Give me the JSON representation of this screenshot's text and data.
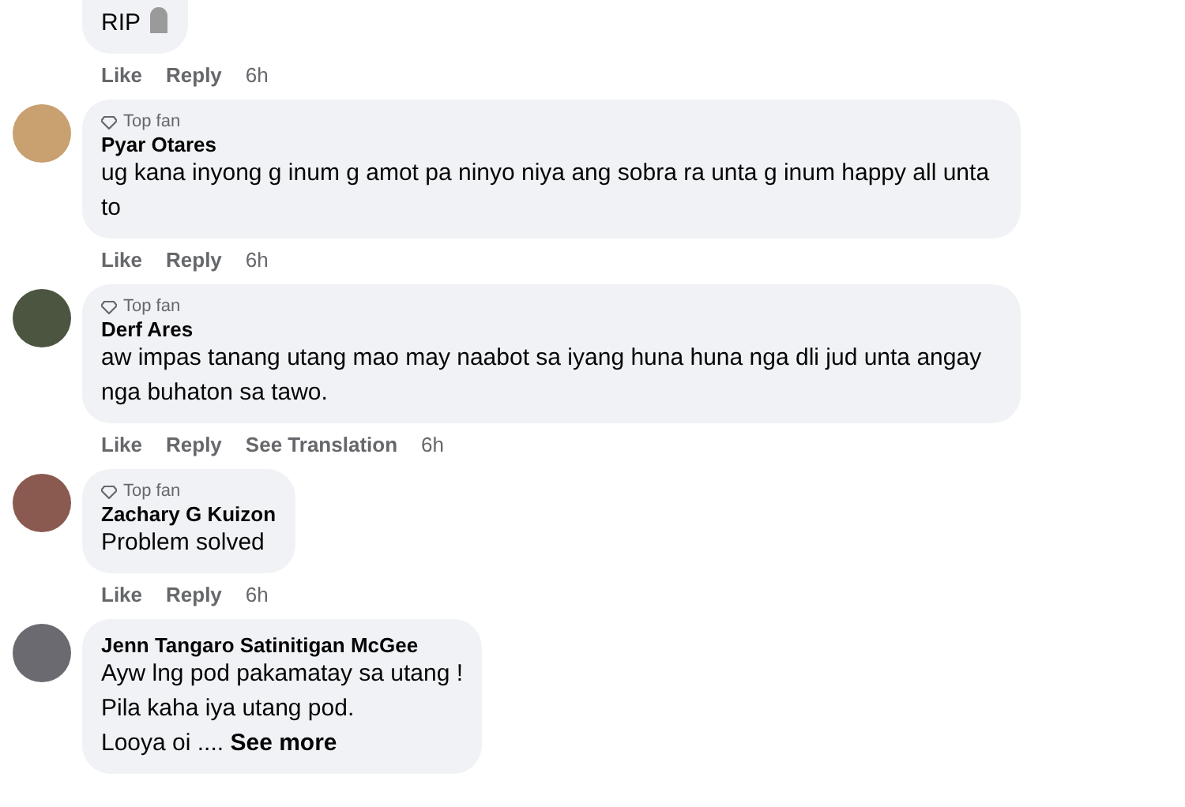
{
  "comments": [
    {
      "cut_top": true,
      "top_fan": false,
      "lines": [
        "RIP"
      ],
      "emoji": true,
      "actions": [
        "Like",
        "Reply"
      ],
      "time": "6h"
    },
    {
      "top_fan": true,
      "badge": "Top fan",
      "name": "Pyar Otares",
      "lines": [
        "ug kana inyong g inum g amot pa ninyo niya ang sobra ra unta g inum happy all unta to"
      ],
      "actions": [
        "Like",
        "Reply"
      ],
      "time": "6h"
    },
    {
      "top_fan": true,
      "badge": "Top fan",
      "name": "Derf Ares",
      "lines": [
        "aw impas tanang utang mao may naabot sa iyang huna huna nga dli jud unta angay nga buhaton sa tawo."
      ],
      "actions": [
        "Like",
        "Reply",
        "See Translation"
      ],
      "time": "6h"
    },
    {
      "top_fan": true,
      "badge": "Top fan",
      "name": "Zachary G Kuizon",
      "lines": [
        "Problem solved"
      ],
      "actions": [
        "Like",
        "Reply"
      ],
      "time": "6h"
    },
    {
      "top_fan": false,
      "name": "Jenn Tangaro Satinitigan McGee",
      "lines": [
        "Ayw lng pod pakamatay sa utang !",
        "Pila kaha iya utang pod.",
        "Looya oi ...."
      ],
      "see_more": "See more"
    }
  ]
}
